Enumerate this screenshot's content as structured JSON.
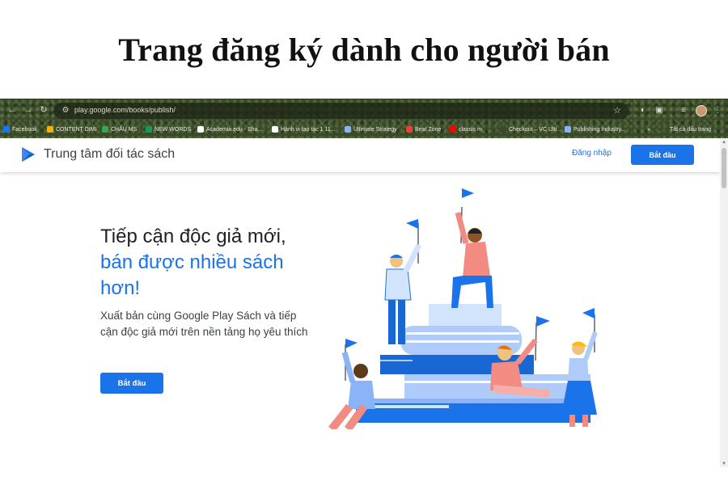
{
  "caption": {
    "title": "Trang đăng ký dành cho người bán"
  },
  "browser": {
    "url": "play.google.com/books/publish/",
    "bookmarks": [
      {
        "label": "Facebook",
        "color": "#1877f2"
      },
      {
        "label": "CONTENT DIMI",
        "color": "#f4b400"
      },
      {
        "label": "CHÂU MS",
        "color": "#34a853"
      },
      {
        "label": "NEW WORDS",
        "color": "#0f9d58"
      },
      {
        "label": "Academia.edu - Sha...",
        "color": "#ffffff"
      },
      {
        "label": "Hành vi tạo tác 1 11...",
        "color": "#ffffff"
      },
      {
        "label": "Ultimate Strategy",
        "color": "#8ab4f8"
      },
      {
        "label": "Beat Zone",
        "color": "#ea4335"
      },
      {
        "label": "classic m",
        "color": "#ff0000"
      },
      {
        "label": "Checkout – VC Ulti...",
        "color": "#3b4a2a"
      },
      {
        "label": "Publishing Industry...",
        "color": "#8ab4f8"
      },
      {
        "label": "»",
        "color": ""
      },
      {
        "label": "Tất cả dấu trang",
        "color": ""
      }
    ]
  },
  "header": {
    "site_title": "Trung tâm đối tác sách",
    "login_label": "Đăng nhập",
    "start_label": "Bắt đầu"
  },
  "hero": {
    "title_line1": "Tiếp cận độc giả mới,",
    "title_line2": "bán được nhiều sách hơn!",
    "description": "Xuất bản cùng Google Play Sách và tiếp cận độc giả mới trên nền tảng họ yêu thích",
    "start_label": "Bắt đầu"
  },
  "colors": {
    "accent": "#1a73e8",
    "book_dark": "#1967d2",
    "book_light": "#aecbfa"
  }
}
